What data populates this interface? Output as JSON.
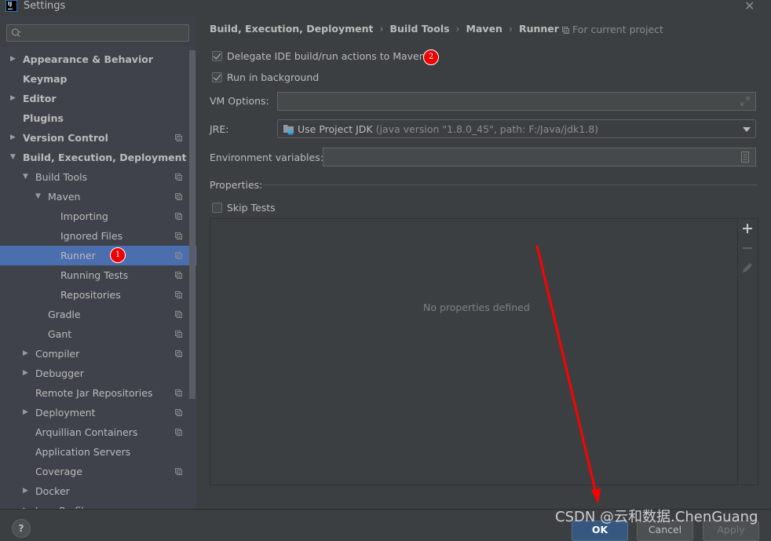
{
  "window": {
    "title": "Settings",
    "logo_text": "IJ",
    "close_icon": "close-x-icon"
  },
  "sidebar": {
    "search": {
      "value": "",
      "placeholder": ""
    },
    "items": [
      {
        "label": "Appearance & Behavior",
        "bold": true,
        "arrow": "right",
        "project_icon": false
      },
      {
        "label": "Keymap",
        "bold": true,
        "arrow": "",
        "project_icon": false
      },
      {
        "label": "Editor",
        "bold": true,
        "arrow": "right",
        "project_icon": false
      },
      {
        "label": "Plugins",
        "bold": true,
        "arrow": "",
        "project_icon": false
      },
      {
        "label": "Version Control",
        "bold": true,
        "arrow": "right",
        "project_icon": true
      },
      {
        "label": "Build, Execution, Deployment",
        "bold": true,
        "arrow": "down",
        "project_icon": false
      },
      {
        "label": "Build Tools",
        "bold": false,
        "arrow": "down",
        "project_icon": true
      },
      {
        "label": "Maven",
        "bold": false,
        "arrow": "down",
        "project_icon": true
      },
      {
        "label": "Importing",
        "bold": false,
        "arrow": "",
        "project_icon": true
      },
      {
        "label": "Ignored Files",
        "bold": false,
        "arrow": "",
        "project_icon": true
      },
      {
        "label": "Runner",
        "bold": false,
        "arrow": "",
        "project_icon": true,
        "selected": true
      },
      {
        "label": "Running Tests",
        "bold": false,
        "arrow": "",
        "project_icon": true
      },
      {
        "label": "Repositories",
        "bold": false,
        "arrow": "",
        "project_icon": true
      },
      {
        "label": "Gradle",
        "bold": false,
        "arrow": "",
        "project_icon": true
      },
      {
        "label": "Gant",
        "bold": false,
        "arrow": "",
        "project_icon": true
      },
      {
        "label": "Compiler",
        "bold": false,
        "arrow": "right",
        "project_icon": true
      },
      {
        "label": "Debugger",
        "bold": false,
        "arrow": "right",
        "project_icon": false
      },
      {
        "label": "Remote Jar Repositories",
        "bold": false,
        "arrow": "",
        "project_icon": true
      },
      {
        "label": "Deployment",
        "bold": false,
        "arrow": "right",
        "project_icon": true
      },
      {
        "label": "Arquillian Containers",
        "bold": false,
        "arrow": "",
        "project_icon": true
      },
      {
        "label": "Application Servers",
        "bold": false,
        "arrow": "",
        "project_icon": false
      },
      {
        "label": "Coverage",
        "bold": false,
        "arrow": "",
        "project_icon": true
      },
      {
        "label": "Docker",
        "bold": false,
        "arrow": "right",
        "project_icon": false
      },
      {
        "label": "Java Profiler",
        "bold": false,
        "arrow": "right",
        "project_icon": false
      }
    ]
  },
  "main": {
    "breadcrumb": [
      "Build, Execution, Deployment",
      "Build Tools",
      "Maven",
      "Runner"
    ],
    "breadcrumb_separator": "›",
    "scope_label": "For current project",
    "delegate_checkbox": {
      "label": "Delegate IDE build/run actions to Maven",
      "checked": true
    },
    "background_checkbox": {
      "label": "Run in background",
      "checked": true
    },
    "vm_options": {
      "label": "VM Options:",
      "value": ""
    },
    "jre": {
      "label": "JRE:",
      "selected": "Use Project JDK",
      "detail": "(java version \"1.8.0_45\", path: F:/Java/jdk1.8)"
    },
    "env_vars": {
      "label": "Environment variables:",
      "value": ""
    },
    "properties_label": "Properties:",
    "skip_tests": {
      "label": "Skip Tests",
      "checked": false
    },
    "properties_empty_text": "No properties defined",
    "properties_toolbar": [
      "add-icon",
      "remove-icon",
      "edit-icon"
    ]
  },
  "footer": {
    "help_label": "?",
    "ok_label": "OK",
    "cancel_label": "Cancel",
    "apply_label": "Apply"
  },
  "annotations": {
    "badge_1": "1",
    "badge_2": "2",
    "badge_color": "#ee0000",
    "arrow_color": "#ff0000",
    "watermark": "CSDN @云和数据.ChenGuang"
  },
  "colors": {
    "background": "#3c3f41",
    "sidebar": "#3f424b",
    "selection": "#4b6eaf",
    "ok_button": "#365880"
  }
}
